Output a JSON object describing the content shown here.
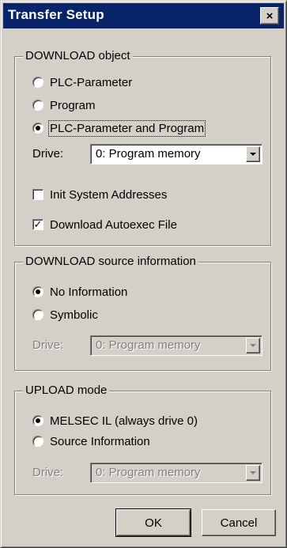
{
  "window": {
    "title": "Transfer Setup",
    "close_symbol": "×"
  },
  "download_object": {
    "group_label": "DOWNLOAD object",
    "options": [
      "PLC-Parameter",
      "Program",
      "PLC-Parameter and Program"
    ],
    "selected": "PLC-Parameter and Program",
    "drive_label": "Drive:",
    "drive_value": "0: Program memory",
    "init_system_addresses_label": "Init System Addresses",
    "init_system_addresses_checked": false,
    "download_autoexec_label": "Download Autoexec File",
    "download_autoexec_checked": true
  },
  "download_source": {
    "group_label": "DOWNLOAD source information",
    "options": [
      "No Information",
      "Symbolic"
    ],
    "selected": "No Information",
    "drive_label": "Drive:",
    "drive_value": "0: Program memory"
  },
  "upload_mode": {
    "group_label": "UPLOAD mode",
    "options": [
      "MELSEC IL (always drive 0)",
      "Source Information"
    ],
    "selected": "MELSEC IL (always drive 0)",
    "drive_label": "Drive:",
    "drive_value": "0: Program memory"
  },
  "buttons": {
    "ok": "OK",
    "cancel": "Cancel"
  }
}
